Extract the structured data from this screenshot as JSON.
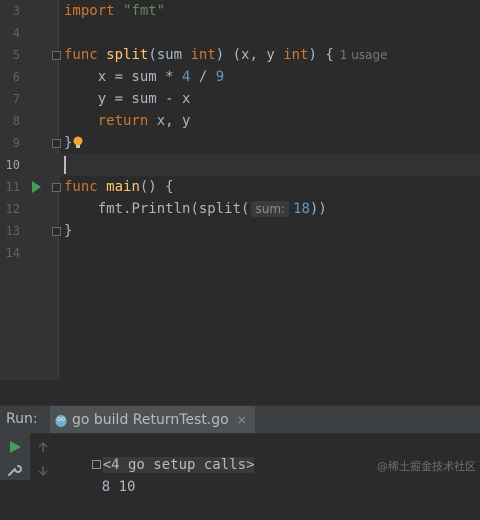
{
  "editor": {
    "lines": [
      {
        "num": "3"
      },
      {
        "num": "4"
      },
      {
        "num": "5"
      },
      {
        "num": "6"
      },
      {
        "num": "7"
      },
      {
        "num": "8"
      },
      {
        "num": "9"
      },
      {
        "num": "10"
      },
      {
        "num": "11"
      },
      {
        "num": "12"
      },
      {
        "num": "13"
      },
      {
        "num": "14"
      }
    ],
    "tokens": {
      "import_kw": "import",
      "import_path": "\"fmt\"",
      "func_kw": "func",
      "split_name": "split",
      "split_params_open": "(sum ",
      "int_kw_1": "int",
      "split_params_close": ") (x, y ",
      "int_kw_2": "int",
      "split_brace": ") {",
      "usage_hint": "1 usage",
      "x_assign": "    x = sum * ",
      "four": "4",
      "div": " / ",
      "nine": "9",
      "y_assign": "    y = sum - x",
      "return_kw": "return",
      "return_vals": " x, y",
      "close_brace": "}",
      "func_kw_2": "func",
      "main_name": "main",
      "main_rest": "() {",
      "println_call": "    fmt.",
      "println_name": "Println",
      "split_call": "(split(",
      "param_hint": "sum:",
      "eighteen": "18",
      "call_close": "))",
      "close_brace_2": "}"
    }
  },
  "run_panel": {
    "label": "Run:",
    "tab_label": "go build ReturnTest.go",
    "tab_close": "×",
    "console": {
      "setup_calls": "<4 go setup calls>",
      "output": "8 10"
    }
  },
  "watermark": "@稀土掘金技术社区",
  "colors": {
    "keyword": "#cc7832",
    "function": "#ffc66d",
    "string": "#6a8759",
    "number": "#6897bb",
    "run_green": "#499c54"
  }
}
